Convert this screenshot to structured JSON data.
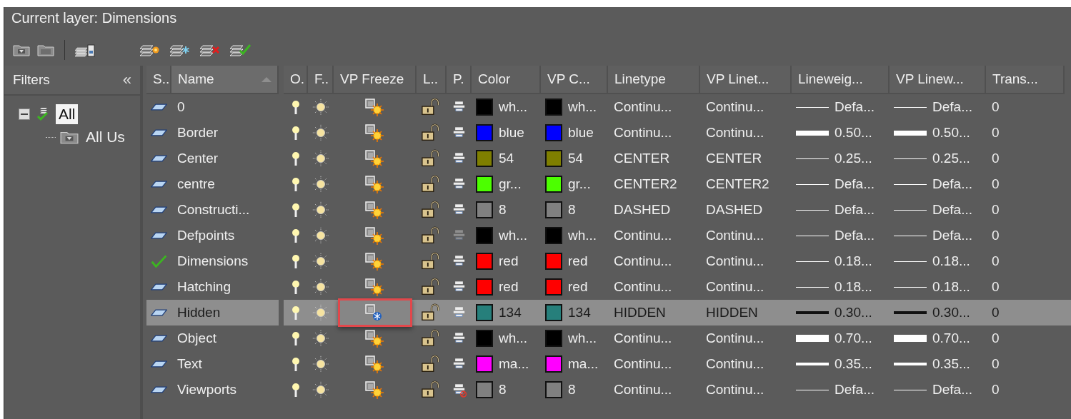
{
  "title": "Current layer: Dimensions",
  "filters": {
    "header": "Filters",
    "collapse": "«",
    "tree": [
      {
        "label": "All",
        "selected": true,
        "expanded": true,
        "current": true,
        "children": [
          {
            "label": "All Us",
            "selected": false
          }
        ]
      }
    ]
  },
  "table": {
    "columns": [
      {
        "label": "S..",
        "sorted": false
      },
      {
        "label": "Name",
        "sorted": true
      },
      {
        "label": "O.",
        "sorted": false
      },
      {
        "label": "F..",
        "sorted": false
      },
      {
        "label": "VP Freeze",
        "sorted": false
      },
      {
        "label": "L..",
        "sorted": false
      },
      {
        "label": "P.",
        "sorted": false
      },
      {
        "label": "Color",
        "sorted": false
      },
      {
        "label": "VP C...",
        "sorted": false
      },
      {
        "label": "Linetype",
        "sorted": false
      },
      {
        "label": "VP Linet...",
        "sorted": false
      },
      {
        "label": "Lineweig...",
        "sorted": false
      },
      {
        "label": "VP Linew...",
        "sorted": false
      },
      {
        "label": "Trans...",
        "sorted": false
      }
    ],
    "rows": [
      {
        "name": "0",
        "current": false,
        "selected": false,
        "on": true,
        "frozen": false,
        "vp_frozen": false,
        "vp_freeze_marked": false,
        "locked": false,
        "plottable": true,
        "greyed": false,
        "layer_color": {
          "color": "#000000",
          "label": "wh..."
        },
        "vp_color": {
          "color": "#000000",
          "label": "wh..."
        },
        "linetype": "Continu...",
        "vp_linetype": "Continu...",
        "lineweight": {
          "kind": "thin",
          "label": "Defa..."
        },
        "vp_lineweight": {
          "kind": "thin",
          "label": "Defa..."
        },
        "transparency": "0"
      },
      {
        "name": "Border",
        "current": false,
        "selected": false,
        "on": true,
        "frozen": false,
        "vp_frozen": false,
        "vp_freeze_marked": false,
        "locked": false,
        "plottable": true,
        "greyed": false,
        "layer_color": {
          "color": "#0000ff",
          "label": "blue"
        },
        "vp_color": {
          "color": "#0000ff",
          "label": "blue"
        },
        "linetype": "Continu...",
        "vp_linetype": "Continu...",
        "lineweight": {
          "kind": "thick",
          "label": "0.50..."
        },
        "vp_lineweight": {
          "kind": "thick",
          "label": "0.50..."
        },
        "transparency": "0"
      },
      {
        "name": "Center",
        "current": false,
        "selected": false,
        "on": true,
        "frozen": false,
        "vp_frozen": false,
        "vp_freeze_marked": false,
        "locked": false,
        "plottable": true,
        "greyed": false,
        "layer_color": {
          "color": "#7f7f00",
          "label": "54"
        },
        "vp_color": {
          "color": "#7f7f00",
          "label": "54"
        },
        "linetype": "CENTER",
        "vp_linetype": "CENTER",
        "lineweight": {
          "kind": "thin",
          "label": "0.25..."
        },
        "vp_lineweight": {
          "kind": "thin",
          "label": "0.25..."
        },
        "transparency": "0"
      },
      {
        "name": "centre",
        "current": false,
        "selected": false,
        "on": true,
        "frozen": false,
        "vp_frozen": false,
        "vp_freeze_marked": false,
        "locked": false,
        "plottable": true,
        "greyed": false,
        "layer_color": {
          "color": "#4cff00",
          "label": "gr..."
        },
        "vp_color": {
          "color": "#4cff00",
          "label": "gr..."
        },
        "linetype": "CENTER2",
        "vp_linetype": "CENTER2",
        "lineweight": {
          "kind": "thin",
          "label": "Defa..."
        },
        "vp_lineweight": {
          "kind": "thin",
          "label": "Defa..."
        },
        "transparency": "0"
      },
      {
        "name": "Constructi...",
        "current": false,
        "selected": false,
        "on": true,
        "frozen": false,
        "vp_frozen": false,
        "vp_freeze_marked": false,
        "locked": false,
        "plottable": true,
        "greyed": false,
        "layer_color": {
          "color": "#808080",
          "label": "8"
        },
        "vp_color": {
          "color": "#808080",
          "label": "8"
        },
        "linetype": "DASHED",
        "vp_linetype": "DASHED",
        "lineweight": {
          "kind": "thin",
          "label": "Defa..."
        },
        "vp_lineweight": {
          "kind": "thin",
          "label": "Defa..."
        },
        "transparency": "0"
      },
      {
        "name": "Defpoints",
        "current": false,
        "selected": false,
        "on": true,
        "frozen": false,
        "vp_frozen": false,
        "vp_freeze_marked": false,
        "locked": false,
        "plottable": true,
        "greyed": true,
        "layer_color": {
          "color": "#000000",
          "label": "wh..."
        },
        "vp_color": {
          "color": "#000000",
          "label": "wh..."
        },
        "linetype": "Continu...",
        "vp_linetype": "Continu...",
        "lineweight": {
          "kind": "thin",
          "label": "Defa..."
        },
        "vp_lineweight": {
          "kind": "thin",
          "label": "Defa..."
        },
        "transparency": "0"
      },
      {
        "name": "Dimensions",
        "current": true,
        "selected": false,
        "on": true,
        "frozen": false,
        "vp_frozen": false,
        "vp_freeze_marked": false,
        "locked": false,
        "plottable": true,
        "greyed": false,
        "layer_color": {
          "color": "#ff0000",
          "label": "red"
        },
        "vp_color": {
          "color": "#ff0000",
          "label": "red"
        },
        "linetype": "Continu...",
        "vp_linetype": "Continu...",
        "lineweight": {
          "kind": "thin",
          "label": "0.18..."
        },
        "vp_lineweight": {
          "kind": "thin",
          "label": "0.18..."
        },
        "transparency": "0"
      },
      {
        "name": "Hatching",
        "current": false,
        "selected": false,
        "on": true,
        "frozen": false,
        "vp_frozen": false,
        "vp_freeze_marked": false,
        "locked": false,
        "plottable": true,
        "greyed": false,
        "layer_color": {
          "color": "#ff0000",
          "label": "red"
        },
        "vp_color": {
          "color": "#ff0000",
          "label": "red"
        },
        "linetype": "Continu...",
        "vp_linetype": "Continu...",
        "lineweight": {
          "kind": "thin",
          "label": "0.18..."
        },
        "vp_lineweight": {
          "kind": "thin",
          "label": "0.18..."
        },
        "transparency": "0"
      },
      {
        "name": "Hidden",
        "current": false,
        "selected": true,
        "on": true,
        "frozen": false,
        "vp_frozen": true,
        "vp_freeze_marked": true,
        "locked": false,
        "plottable": true,
        "greyed": false,
        "layer_color": {
          "color": "#267f7b",
          "label": "134"
        },
        "vp_color": {
          "color": "#267f7b",
          "label": "134"
        },
        "linetype": "HIDDEN",
        "vp_linetype": "HIDDEN",
        "lineweight": {
          "kind": "medium",
          "label": "0.30..."
        },
        "vp_lineweight": {
          "kind": "medium",
          "label": "0.30..."
        },
        "transparency": "0"
      },
      {
        "name": "Object",
        "current": false,
        "selected": false,
        "on": true,
        "frozen": false,
        "vp_frozen": false,
        "vp_freeze_marked": false,
        "locked": false,
        "plottable": true,
        "greyed": false,
        "layer_color": {
          "color": "#000000",
          "label": "wh..."
        },
        "vp_color": {
          "color": "#000000",
          "label": "wh..."
        },
        "linetype": "Continu...",
        "vp_linetype": "Continu...",
        "lineweight": {
          "kind": "heavy",
          "label": "0.70..."
        },
        "vp_lineweight": {
          "kind": "heavy",
          "label": "0.70..."
        },
        "transparency": "0"
      },
      {
        "name": "Text",
        "current": false,
        "selected": false,
        "on": true,
        "frozen": false,
        "vp_frozen": false,
        "vp_freeze_marked": false,
        "locked": false,
        "plottable": true,
        "greyed": false,
        "layer_color": {
          "color": "#ff00ff",
          "label": "ma..."
        },
        "vp_color": {
          "color": "#ff00ff",
          "label": "ma..."
        },
        "linetype": "Continu...",
        "vp_linetype": "Continu...",
        "lineweight": {
          "kind": "medium",
          "label": "0.35..."
        },
        "vp_lineweight": {
          "kind": "medium",
          "label": "0.35..."
        },
        "transparency": "0"
      },
      {
        "name": "Viewports",
        "current": false,
        "selected": false,
        "on": true,
        "frozen": false,
        "vp_frozen": false,
        "vp_freeze_marked": false,
        "locked": false,
        "plottable": false,
        "greyed": false,
        "layer_color": {
          "color": "#808080",
          "label": "8"
        },
        "vp_color": {
          "color": "#808080",
          "label": "8"
        },
        "linetype": "Continu...",
        "vp_linetype": "Continu...",
        "lineweight": {
          "kind": "thin",
          "label": "Defa..."
        },
        "vp_lineweight": {
          "kind": "thin",
          "label": "Defa..."
        },
        "transparency": "0"
      }
    ]
  }
}
